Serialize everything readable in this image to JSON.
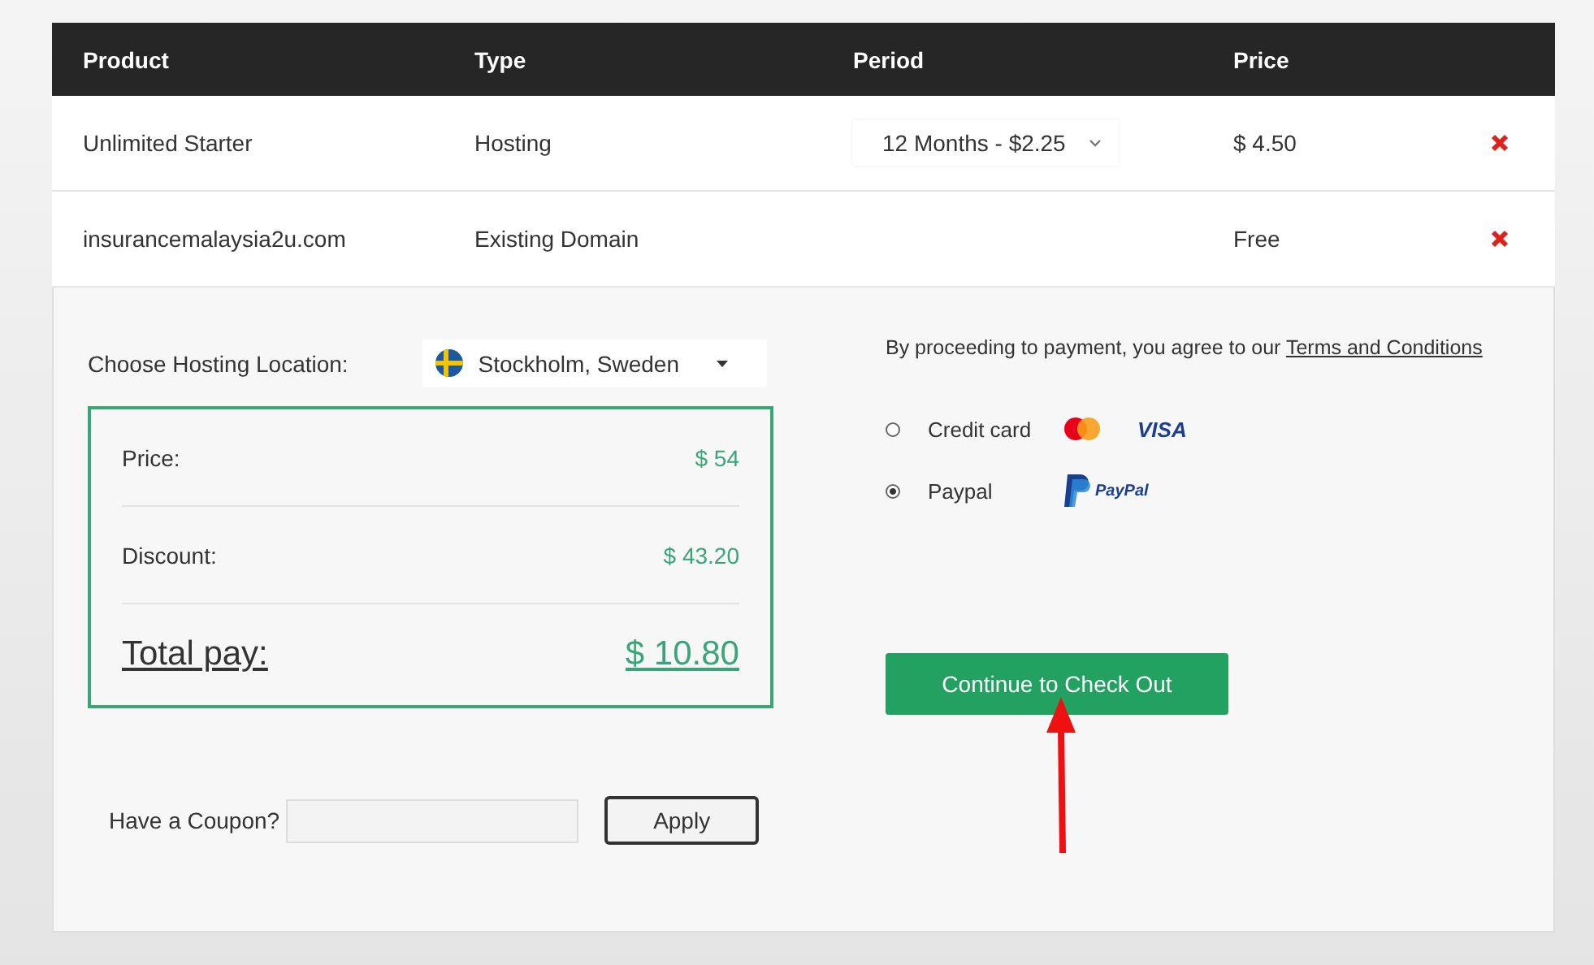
{
  "table": {
    "columns": [
      "Product",
      "Type",
      "Period",
      "Price"
    ],
    "rows": [
      {
        "product": "Unlimited Starter",
        "type": "Hosting",
        "period": "12 Months - $2.25",
        "price": "$ 4.50"
      },
      {
        "product": "insurancemalaysia2u.com",
        "type": "Existing Domain",
        "price": "Free"
      }
    ]
  },
  "location": {
    "label": "Choose Hosting Location:",
    "value": "Stockholm, Sweden"
  },
  "summary": [
    {
      "kind": "line",
      "label": "Price:",
      "value": "$ 54"
    },
    {
      "kind": "line",
      "label": "Discount:",
      "value": "$ 43.20"
    },
    {
      "kind": "total",
      "label": "Total pay:",
      "value": "$ 10.80"
    }
  ],
  "coupon": {
    "label": "Have a Coupon?",
    "button": "Apply"
  },
  "agreement": {
    "text": "By proceeding to payment, you agree to our",
    "link": "Terms and Conditions"
  },
  "payment_methods": [
    {
      "label": "Credit card",
      "kind": "card",
      "selected": false
    },
    {
      "label": "Paypal",
      "kind": "paypal",
      "selected": true
    }
  ],
  "brand_texts": {
    "visa": "VISA",
    "paypal": "PayPal"
  },
  "checkout_button": "Continue to Check Out"
}
